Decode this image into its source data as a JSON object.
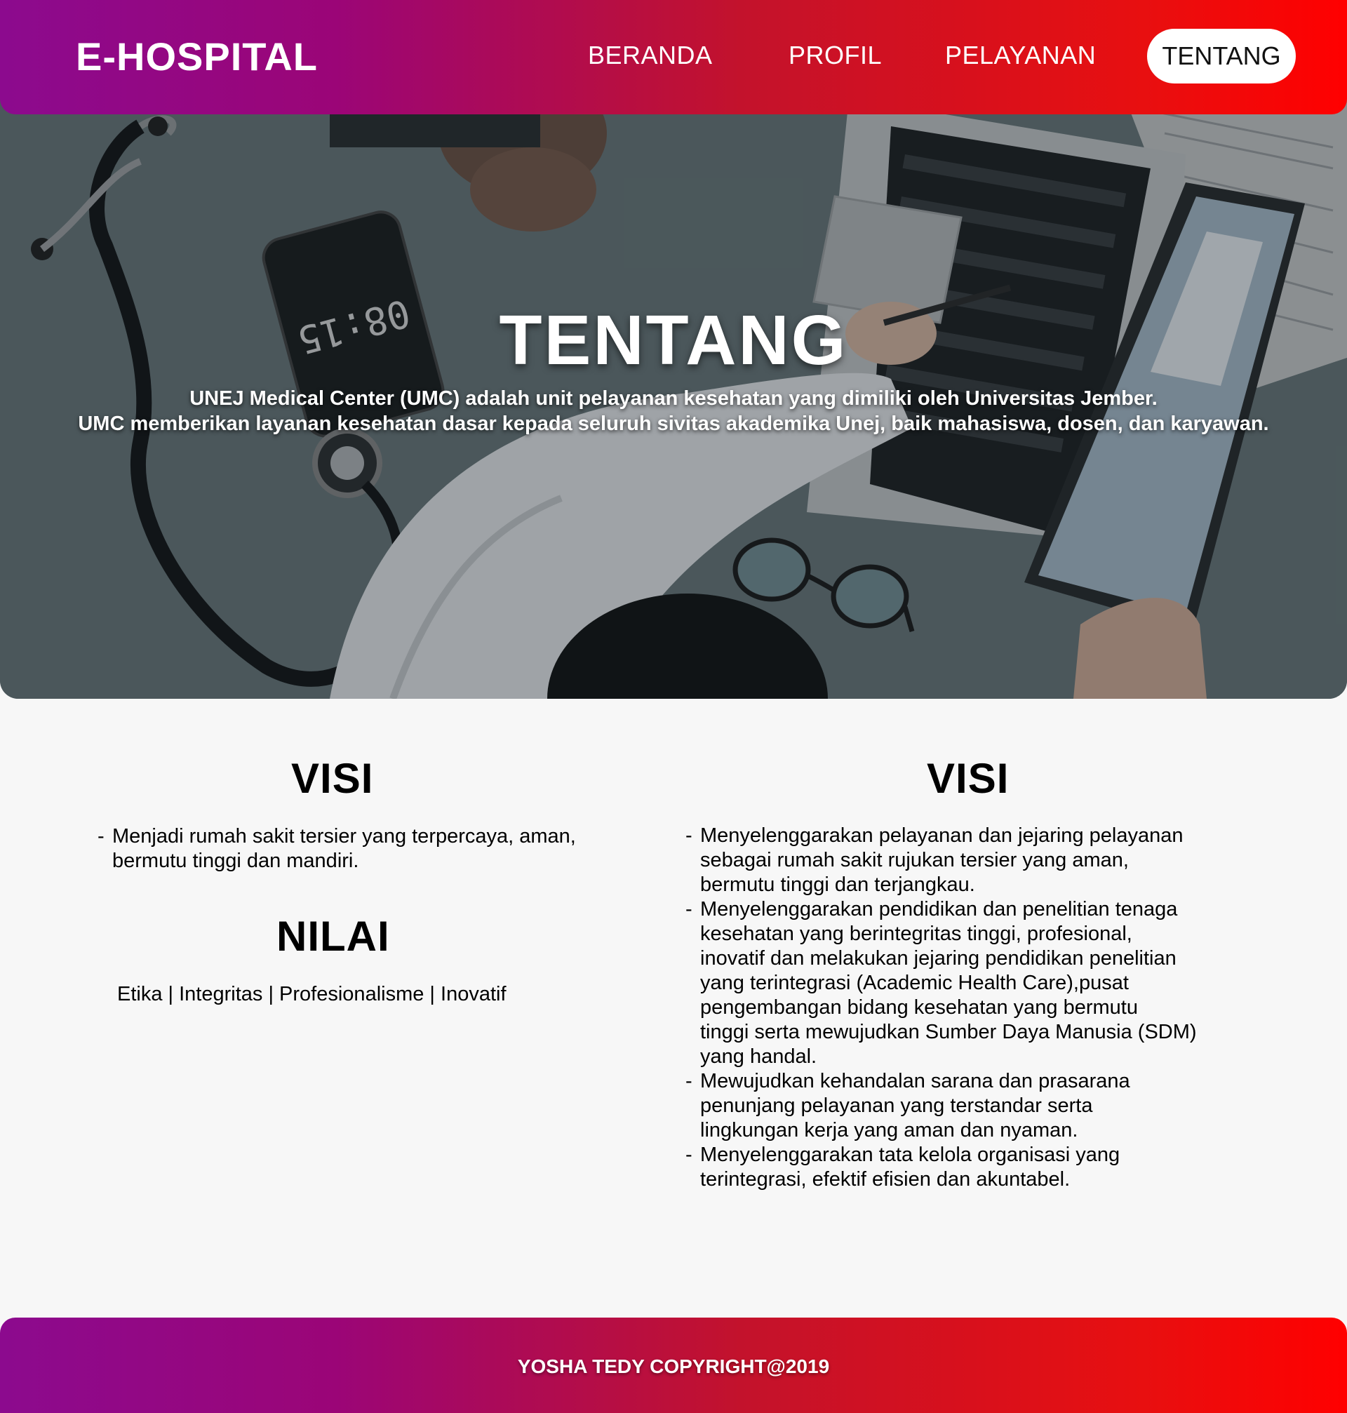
{
  "navbar": {
    "brand": "E-HOSPITAL",
    "links": [
      "BERANDA",
      "PROFIL",
      "PELAYANAN",
      "TENTANG"
    ],
    "active": "TENTANG"
  },
  "hero": {
    "title": "TENTANG",
    "line1": "UNEJ Medical Center (UMC) adalah unit pelayanan kesehatan yang dimiliki oleh Universitas Jember.",
    "line2": "UMC memberikan layanan kesehatan dasar kepada seluruh sivitas akademika Unej, baik mahasiswa, dosen, dan karyawan.",
    "image_clock": "08:15"
  },
  "left": {
    "visi_title": "VISI",
    "visi_items": [
      [
        "Menjadi rumah sakit tersier yang terpercaya, aman,",
        "bermutu tinggi dan mandiri."
      ]
    ],
    "nilai_title": "NILAI",
    "nilai_text": "Etika | Integritas | Profesionalisme | Inovatif"
  },
  "right": {
    "title": "VISI",
    "items": [
      [
        "Menyelenggarakan pelayanan dan jejaring pelayanan",
        "sebagai rumah sakit rujukan tersier yang aman,",
        "bermutu tinggi dan terjangkau."
      ],
      [
        "Menyelenggarakan pendidikan dan penelitian tenaga",
        "kesehatan yang berintegritas tinggi, profesional,",
        "inovatif dan melakukan jejaring pendidikan penelitian",
        "yang terintegrasi (Academic Health Care),pusat",
        "pengembangan bidang kesehatan yang bermutu",
        "tinggi serta mewujudkan Sumber Daya Manusia (SDM)",
        "yang handal."
      ],
      [
        "Mewujudkan kehandalan sarana dan prasarana",
        "penunjang pelayanan yang terstandar serta",
        "lingkungan kerja yang aman dan nyaman."
      ],
      [
        "Menyelenggarakan tata kelola organisasi yang",
        "terintegrasi, efektif efisien dan akuntabel."
      ]
    ]
  },
  "footer": {
    "text": "YOSHA TEDY COPYRIGHT@2019"
  },
  "colors": {
    "gradient_start": "#8c0a8e",
    "gradient_end": "#ff0000",
    "page_bg": "#f7f7f7"
  }
}
